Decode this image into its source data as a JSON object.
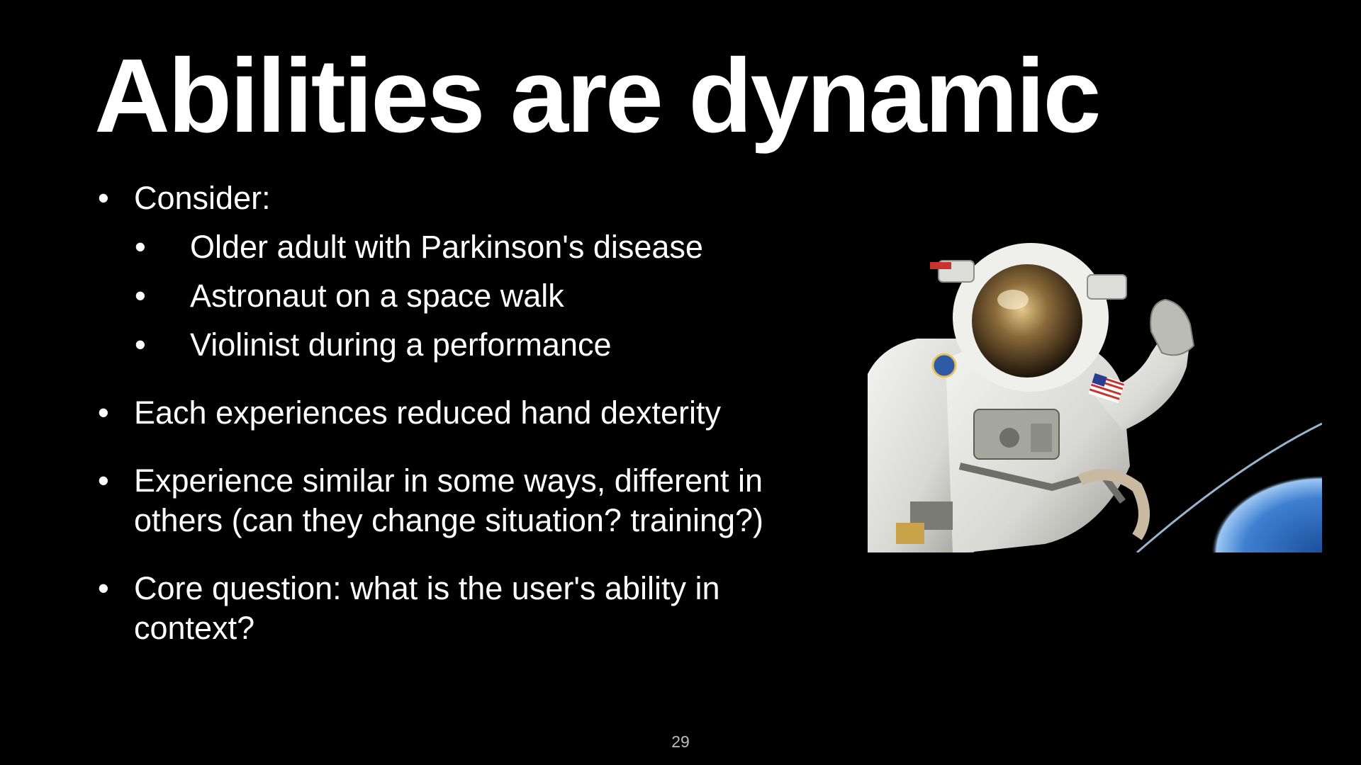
{
  "slide": {
    "title": "Abilities are dynamic",
    "bullets": [
      {
        "text": "Consider:"
      },
      {
        "text": "Each experiences reduced hand dexterity"
      },
      {
        "text": "Experience similar in some ways, different in others (can they change situation? training?)"
      },
      {
        "text": "Core question: what is the user's ability in context?"
      }
    ],
    "sub_bullets": [
      "Older adult with Parkinson's disease",
      "Astronaut on a space walk",
      "Violinist during a performance"
    ],
    "image": {
      "subject": "astronaut-in-spacesuit-above-earth"
    },
    "page_number": "29"
  },
  "colors": {
    "background": "#000000",
    "text": "#ffffff",
    "page_number": "#bdbdbd"
  }
}
